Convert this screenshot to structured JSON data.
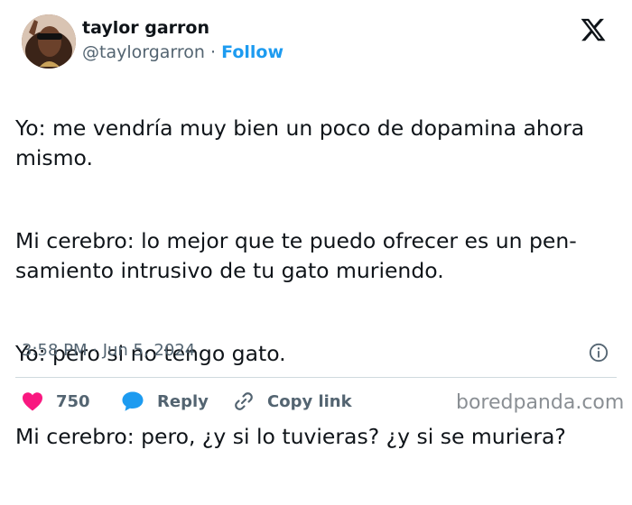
{
  "author": {
    "name": "taylor garron",
    "handle": "@taylorgarron",
    "separator": "·",
    "follow_label": "Follow"
  },
  "logo_icon": "x-logo-icon",
  "tweet": {
    "paragraphs": [
      "Yo: me vendría muy bien un poco de dopamina ahora mismo.",
      "Mi cerebro: lo mejor que te puedo ofrecer es un pen-\nsamiento intrusivo de tu gato muriendo.",
      "Yo: pero si no tengo gato.",
      "Mi cerebro: pero, ¿y si lo tuvieras? ¿y si se muriera?"
    ]
  },
  "meta": {
    "timestamp": "3:58 PM · Jun 5, 2024",
    "info_icon": "info-icon"
  },
  "actions": {
    "like_count": "750",
    "reply_label": "Reply",
    "copy_link_label": "Copy link"
  },
  "colors": {
    "like": "#f91880",
    "reply": "#1d9bf0",
    "follow": "#1d9bf0",
    "muted": "#536471"
  },
  "watermark": "boredpanda.com"
}
